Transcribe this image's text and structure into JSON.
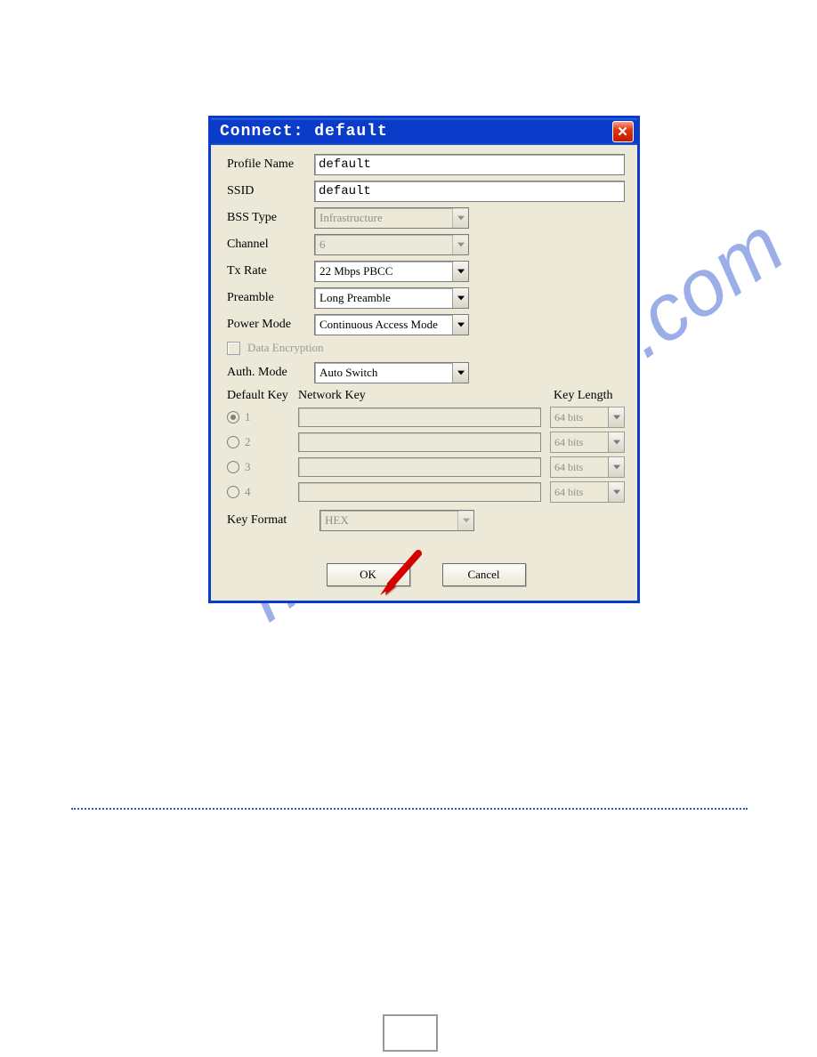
{
  "watermark_text": "manualshive.com",
  "dialog": {
    "title": "Connect: default",
    "profile_name_label": "Profile Name",
    "profile_name_value": "default",
    "ssid_label": "SSID",
    "ssid_value": "default",
    "bss_type_label": "BSS Type",
    "bss_type_value": "Infrastructure",
    "channel_label": "Channel",
    "channel_value": "6",
    "tx_rate_label": "Tx Rate",
    "tx_rate_value": "22 Mbps PBCC",
    "preamble_label": "Preamble",
    "preamble_value": "Long Preamble",
    "power_mode_label": "Power Mode",
    "power_mode_value": "Continuous Access Mode",
    "data_encryption_label": "Data Encryption",
    "auth_mode_label": "Auth. Mode",
    "auth_mode_value": "Auto Switch",
    "default_key_label": "Default Key",
    "network_key_label": "Network Key",
    "key_length_label": "Key Length",
    "keys": [
      {
        "n": "1",
        "len": "64 bits",
        "selected": true
      },
      {
        "n": "2",
        "len": "64 bits",
        "selected": false
      },
      {
        "n": "3",
        "len": "64 bits",
        "selected": false
      },
      {
        "n": "4",
        "len": "64 bits",
        "selected": false
      }
    ],
    "key_format_label": "Key Format",
    "key_format_value": "HEX",
    "ok_label": "OK",
    "cancel_label": "Cancel"
  },
  "page_number": ""
}
